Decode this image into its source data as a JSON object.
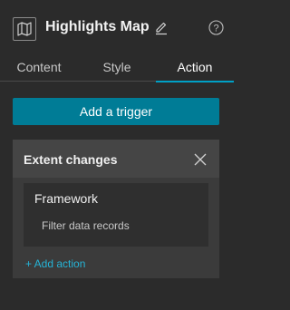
{
  "header": {
    "title": "Highlights Map",
    "icons": [
      "map-icon",
      "pencil-icon",
      "help-icon"
    ]
  },
  "tabs": [
    {
      "label": "Content",
      "active": false
    },
    {
      "label": "Style",
      "active": false
    },
    {
      "label": "Action",
      "active": true
    }
  ],
  "add_trigger_label": "Add a trigger",
  "trigger": {
    "title": "Extent changes",
    "framework": "Framework",
    "actions": [
      "Filter data records"
    ],
    "add_action_label": "+ Add action"
  },
  "colors": {
    "background": "#2b2b2b",
    "accent": "#00a0c6",
    "button": "#007c96",
    "link": "#26b3d6"
  }
}
